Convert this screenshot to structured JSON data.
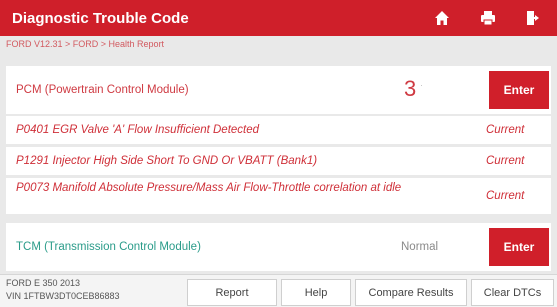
{
  "header": {
    "title": "Diagnostic Trouble Code",
    "accent_color": "#cf1f2a",
    "icons": [
      "home-icon",
      "printer-icon",
      "exit-icon"
    ]
  },
  "breadcrumb": "FORD V12.31 > FORD > Health Report",
  "modules": [
    {
      "name": "PCM (Powertrain Control Module)",
      "count": "3",
      "enter_label": "Enter"
    },
    {
      "name": "TCM (Transmission Control Module)",
      "status": "Normal",
      "enter_label": "Enter"
    }
  ],
  "dtcs": [
    {
      "text": "P0401 EGR Valve 'A' Flow Insufficient Detected",
      "status": "Current"
    },
    {
      "text": "P1291 Injector High Side Short To GND Or VBATT (Bank1)",
      "status": "Current"
    },
    {
      "text": "P0073 Manifold Absolute Pressure/Mass Air Flow-Throttle correlation at idle",
      "status": "Current"
    }
  ],
  "footer": {
    "vehicle_line1": "FORD E 350 2013",
    "vehicle_line2": "VIN 1FTBW3DT0CEB86883",
    "buttons": {
      "report": "Report",
      "help": "Help",
      "compare": "Compare Results",
      "clear": "Clear DTCs"
    }
  }
}
